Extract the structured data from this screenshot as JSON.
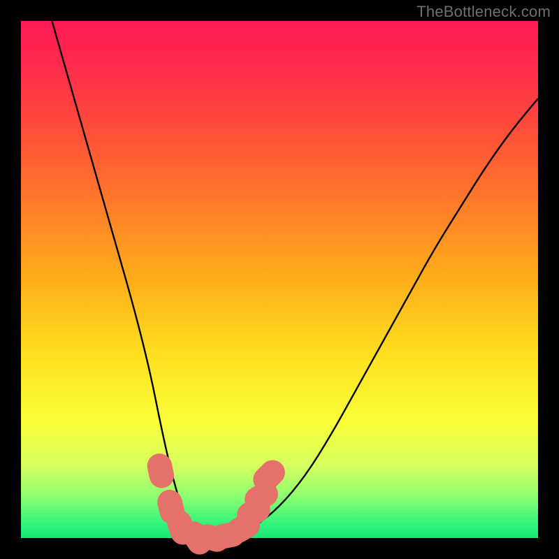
{
  "watermark": "TheBottleneck.com",
  "chart_data": {
    "type": "line",
    "title": "",
    "xlabel": "",
    "ylabel": "",
    "xlim": [
      0,
      100
    ],
    "ylim": [
      0,
      100
    ],
    "grid": false,
    "legend": false,
    "note": "Bottleneck-style V-curve over a red→green vertical gradient; no axis ticks labeled. Values are estimated from pixel positions; y=0 is green bottom, y=100 is red top.",
    "series": [
      {
        "name": "bottleneck-curve",
        "stroke": "#000000",
        "x": [
          6,
          10,
          14,
          18,
          22,
          25,
          27,
          29,
          31,
          33,
          35,
          40,
          45,
          50,
          55,
          60,
          65,
          70,
          75,
          80,
          85,
          90,
          95,
          100
        ],
        "y": [
          100,
          86,
          72,
          58,
          44,
          32,
          22,
          13,
          6,
          2,
          0,
          0,
          2,
          6,
          12,
          20,
          29,
          38,
          47,
          56,
          64,
          72,
          79,
          85
        ]
      }
    ],
    "markers": [
      {
        "name": "marker-valley",
        "color": "#e4716a",
        "r": 2.4,
        "points": [
          {
            "x": 27,
            "y": 13
          },
          {
            "x": 29,
            "y": 6
          },
          {
            "x": 31,
            "y": 2
          },
          {
            "x": 34,
            "y": 0
          },
          {
            "x": 37,
            "y": 0
          },
          {
            "x": 40,
            "y": 0.5
          },
          {
            "x": 43,
            "y": 2
          },
          {
            "x": 45,
            "y": 5
          },
          {
            "x": 46.5,
            "y": 8
          },
          {
            "x": 48,
            "y": 12
          }
        ]
      }
    ]
  }
}
